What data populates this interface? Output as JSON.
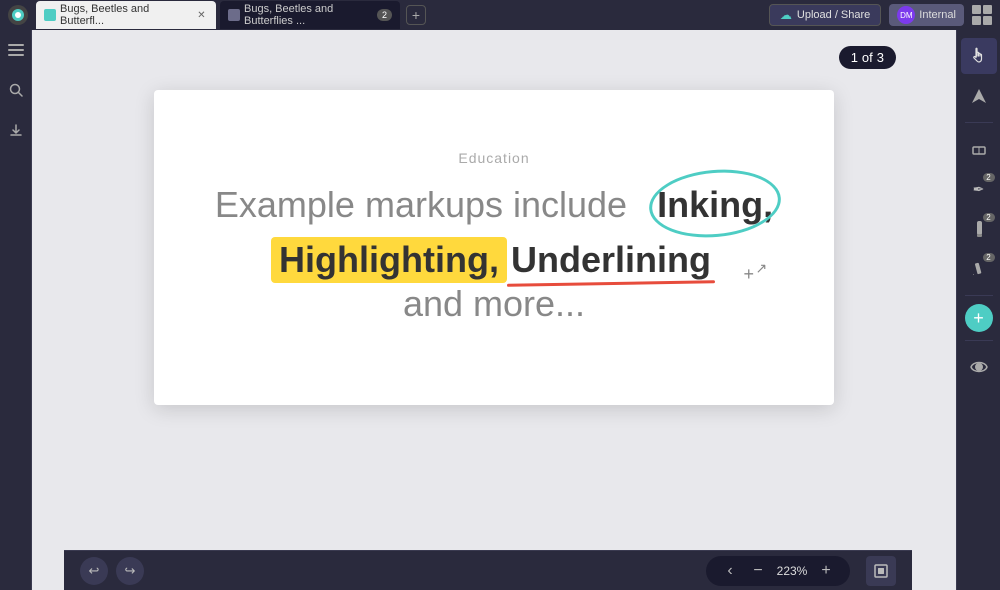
{
  "topbar": {
    "app_icon": "●",
    "tabs": [
      {
        "label": "Bugs, Beetles and Butterfl...",
        "active": true,
        "has_close": true
      },
      {
        "label": "Bugs, Beetles and Butterflies ...",
        "active": false,
        "has_close": false,
        "badge": "2"
      }
    ],
    "add_tab_label": "+",
    "upload_share_label": "Upload / Share",
    "dm_label": "DM",
    "internal_label": "Internal"
  },
  "viewer": {
    "page_current": "1",
    "page_separator": "of",
    "page_total": "3",
    "slide": {
      "category": "Education",
      "line1_prefix": "Example markups include",
      "inking_word": "Inking,",
      "highlight_word": "Highlighting,",
      "underline_word": "Underlining",
      "line2_suffix": "and more..."
    }
  },
  "tools": {
    "hand_icon": "✋",
    "arrow_icon": "▲",
    "eraser_icon": "◇",
    "pen_icon": "✏",
    "pen_badge": "2",
    "marker_icon": "🖍",
    "marker_badge": "2",
    "pencil_icon": "/",
    "pencil_badge": "2",
    "plus_icon": "+",
    "eye_icon": "👁"
  },
  "bottombar": {
    "undo_icon": "↩",
    "redo_icon": "↪",
    "zoom_minus": "−",
    "zoom_value": "223%",
    "zoom_plus": "+",
    "fit_icon": "⊡"
  },
  "left_sidebar": {
    "menu_icon": "☰",
    "search_icon": "⌕",
    "download_icon": "⬇"
  }
}
